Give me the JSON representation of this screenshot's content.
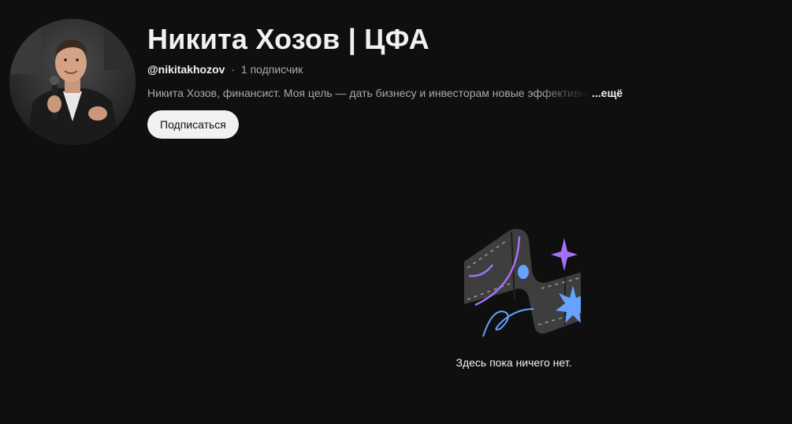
{
  "channel": {
    "title": "Никита Хозов | ЦФА",
    "handle": "@nikitakhozov",
    "separator": "·",
    "subscribers": "1 подписчик",
    "description": "Никита Хозов, финансист. Моя цель — дать бизнесу и инвесторам новые эффективные",
    "more_label": "...ещё",
    "avatar_icon": "person-photo-icon"
  },
  "actions": {
    "subscribe_label": "Подписаться"
  },
  "empty_state": {
    "message": "Здесь пока ничего нет.",
    "illustration_icon": "empty-content-illustration-icon"
  },
  "colors": {
    "background": "#0f0f0f",
    "text_primary": "#f1f1f1",
    "text_secondary": "#aaaaaa",
    "button_bg": "#f1f1f1",
    "illustration_purple": "#a371f7",
    "illustration_blue": "#65a3ff",
    "illustration_gray": "#3e3e3e"
  }
}
